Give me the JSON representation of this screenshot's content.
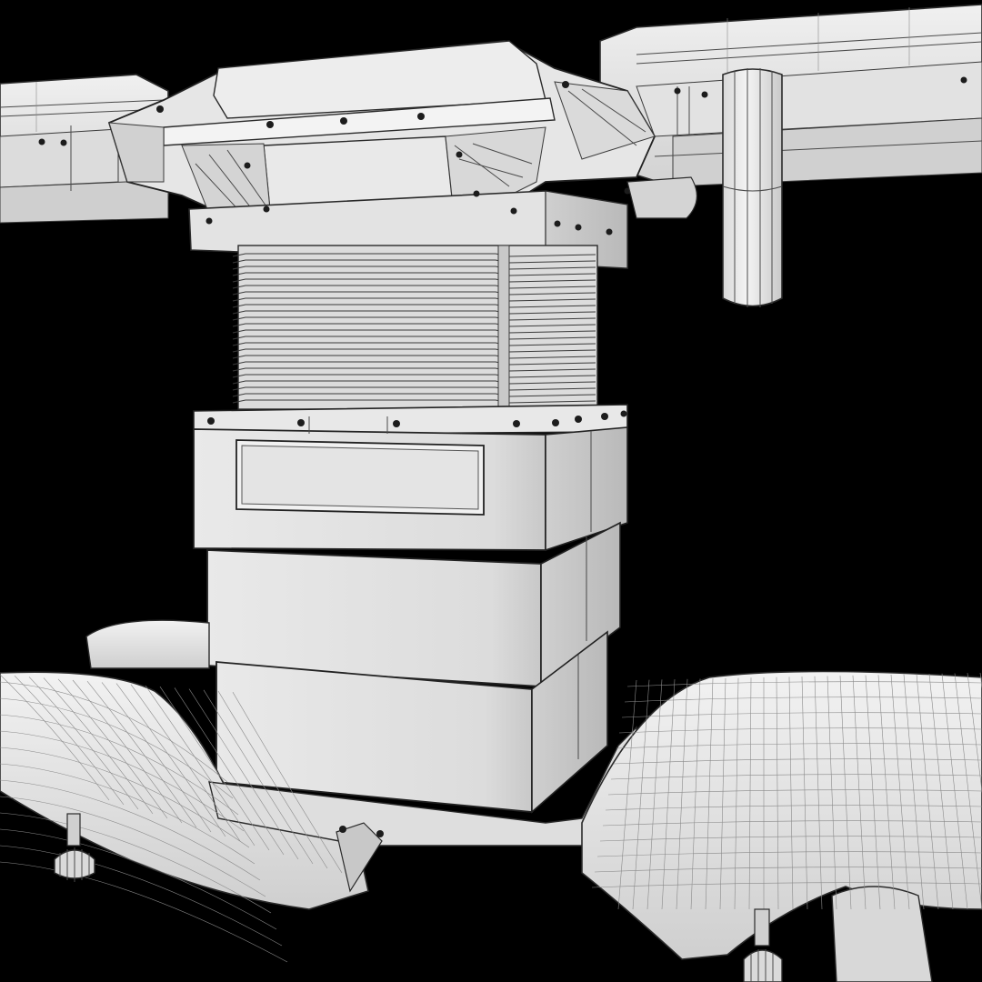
{
  "scene": {
    "background": "#000000",
    "model_base_color": "#e4e4e4",
    "shade_light": "#efefef",
    "shade_mid": "#d6d6d6",
    "shade_dark": "#bdbdbd",
    "wire_color": "#4a4a4a",
    "parts": [
      "overhead-rail",
      "rail-clamp-head",
      "bellows-column",
      "column-base-block",
      "handle-recess",
      "stepped-lower-block",
      "hanging-cylinder",
      "padded-table-top",
      "leveling-feet"
    ]
  }
}
